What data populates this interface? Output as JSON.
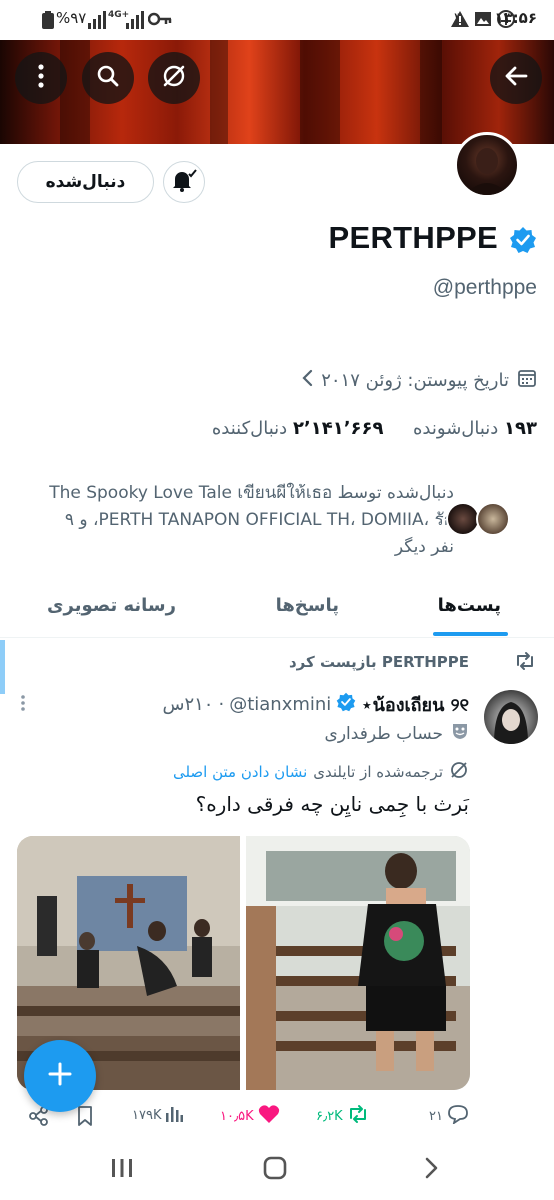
{
  "status_bar": {
    "time": "۱۳:۵۶",
    "notification_count": "۳",
    "battery": "%۹۷",
    "network_label": "4G+"
  },
  "banner": {
    "icons": [
      "more-vertical-icon",
      "search-icon",
      "grok-icon",
      "back-arrow-icon"
    ]
  },
  "profile": {
    "follow_label": "دنبال‌شده",
    "display_name": "PERTHPPE",
    "handle": "@perthppe",
    "join_date": "تاریخ پیوستن: ژوئن ۲۰۱۷",
    "following_count": "۱۹۳",
    "following_label": "دنبال‌شونده",
    "followers_count": "۲٬۱۴۱٬۶۶۹",
    "followers_label": "دنبال‌کننده",
    "followed_by_line1": "دنبال‌شده توسط The Spooky Love Tale เขียนผีให้เธอ",
    "followed_by_line2": "PERTH TANAPON OFFICIAL TH، DOMIIA، รัก، و ۹",
    "followed_by_line3": "نفر دیگر"
  },
  "tabs": {
    "posts": "پست‌ها",
    "replies": "پاسخ‌ها",
    "media": "رسانه تصویری"
  },
  "tweet": {
    "retweet_text": "PERTHPPE بازپست کرد",
    "author_name": "น้องเถียน ୨୧⋆",
    "author_handle": "@tianxmini",
    "time": "۲۱۰س",
    "fan_label": "حساب طرفداری",
    "translated_label": "ترجمه‌شده از تایلندی",
    "show_original": "نشان دادن متن اصلی",
    "text": "بَرث با جِمی نایِن چه فرقی داره؟",
    "replies": "۲۱",
    "reposts": "۶٫۲K",
    "likes": "۱۰٫۵K",
    "views": "۱۷۹K"
  },
  "colors": {
    "accent": "#1d9bf0",
    "repost": "#00ba7c",
    "like": "#f91880",
    "muted": "#536471"
  }
}
